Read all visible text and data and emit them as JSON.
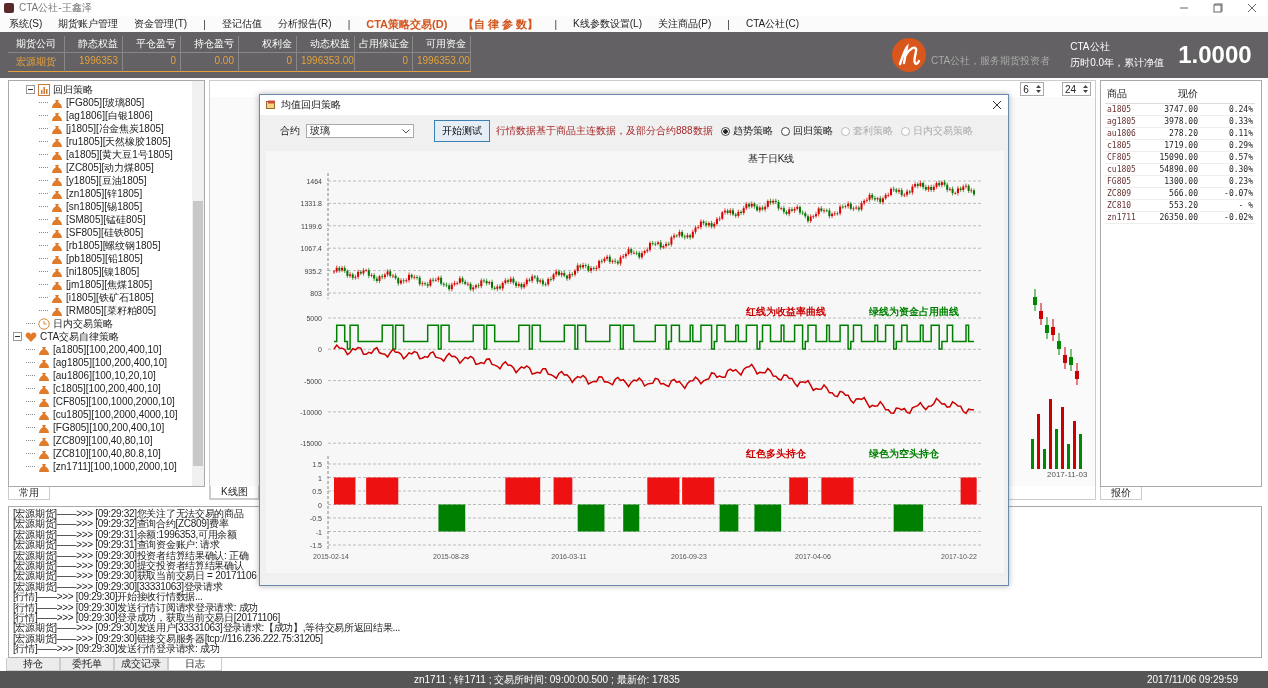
{
  "window": {
    "title": "CTA公社-王鑫泽"
  },
  "menu": [
    {
      "label": "系统(S)",
      "kind": "item"
    },
    {
      "label": "期货账户管理",
      "kind": "item"
    },
    {
      "label": "资金管理(T)",
      "kind": "item"
    },
    {
      "label": "|",
      "kind": "separator"
    },
    {
      "label": "登记估值",
      "kind": "item"
    },
    {
      "label": "分析报告(R)",
      "kind": "item"
    },
    {
      "label": "|",
      "kind": "separator"
    },
    {
      "label": "CTA策略交易(D)",
      "kind": "highlight"
    },
    {
      "label": "【自 律 参 数】",
      "kind": "highlight"
    },
    {
      "label": "|",
      "kind": "separator"
    },
    {
      "label": "K线参数设置(L)",
      "kind": "item"
    },
    {
      "label": "关注商品(P)",
      "kind": "item"
    },
    {
      "label": "|",
      "kind": "separator"
    },
    {
      "label": "CTA公社(C)",
      "kind": "item"
    }
  ],
  "account_table": {
    "columns": [
      "期货公司",
      "静态权益",
      "平仓盈亏",
      "持仓盈亏",
      "权利金",
      "动态权益",
      "占用保证金",
      "可用资金"
    ],
    "rows": [
      [
        "宏源期货",
        "1996353",
        "0",
        "0.00",
        "0",
        "1996353.00",
        "0",
        "1996353.00"
      ]
    ]
  },
  "brand": {
    "tagline": "CTA公社，服务期货投资者",
    "name": "CTA公社",
    "summary": "历时0.0年，累计净值",
    "net_value": "1.0000"
  },
  "tree": {
    "scrolled_branch": [
      {
        "label": "回归策略",
        "kind": "chart",
        "expanded": true,
        "children": [
          {
            "label": "[FG805][玻璃805]",
            "kind": "bag"
          },
          {
            "label": "[ag1806][白银1806]",
            "kind": "bag"
          },
          {
            "label": "[j1805][冶金焦炭1805]",
            "kind": "bag"
          },
          {
            "label": "[ru1805][天然橡胶1805]",
            "kind": "bag"
          },
          {
            "label": "[a1805][黄大豆1号1805]",
            "kind": "bag"
          },
          {
            "label": "[ZC805][动力煤805]",
            "kind": "bag"
          },
          {
            "label": "[y1805][豆油1805]",
            "kind": "bag"
          },
          {
            "label": "[zn1805][锌1805]",
            "kind": "bag"
          },
          {
            "label": "[sn1805][锡1805]",
            "kind": "bag"
          },
          {
            "label": "[SM805][锰硅805]",
            "kind": "bag"
          },
          {
            "label": "[SF805][硅铁805]",
            "kind": "bag"
          },
          {
            "label": "[rb1805][螺纹钢1805]",
            "kind": "bag"
          },
          {
            "label": "[pb1805][铅1805]",
            "kind": "bag"
          },
          {
            "label": "[ni1805][镍1805]",
            "kind": "bag"
          },
          {
            "label": "[jm1805][焦煤1805]",
            "kind": "bag"
          },
          {
            "label": "[i1805][铁矿石1805]",
            "kind": "bag"
          },
          {
            "label": "[RM805][菜籽粕805]",
            "kind": "bag"
          }
        ]
      },
      {
        "label": "日内交易策略",
        "kind": "clock"
      }
    ],
    "items": [
      {
        "label": "CTA交易自律策略",
        "kind": "heart",
        "expanded": true,
        "children": [
          {
            "label": "[a1805][100,200,400,10]",
            "kind": "bag"
          },
          {
            "label": "[ag1805][100,200,400,10]",
            "kind": "bag"
          },
          {
            "label": "[au1806][100,10,20,10]",
            "kind": "bag"
          },
          {
            "label": "[c1805][100,200,400,10]",
            "kind": "bag"
          },
          {
            "label": "[CF805][100,1000,2000,10]",
            "kind": "bag"
          },
          {
            "label": "[cu1805][100,2000,4000,10]",
            "kind": "bag"
          },
          {
            "label": "[FG805][100,200,400,10]",
            "kind": "bag"
          },
          {
            "label": "[ZC809][100,40,80,10]",
            "kind": "bag"
          },
          {
            "label": "[ZC810][100,40,80.8,10]",
            "kind": "bag"
          },
          {
            "label": "[zn1711][100,1000,2000,10]",
            "kind": "bag"
          }
        ]
      }
    ]
  },
  "left_tabs": [
    {
      "label": "常用",
      "selected": true
    }
  ],
  "center": {
    "spinners": [
      "6",
      "24"
    ],
    "date_label": "2017-11-03",
    "tabs": [
      {
        "label": "K线图",
        "selected": true
      }
    ]
  },
  "quotes": {
    "columns": [
      "商品",
      "现价"
    ],
    "rows": [
      {
        "symbol": "a1805",
        "price": "3747.00",
        "change": "0.24%"
      },
      {
        "symbol": "ag1805",
        "price": "3978.00",
        "change": "0.33%"
      },
      {
        "symbol": "au1806",
        "price": "278.20",
        "change": "0.11%"
      },
      {
        "symbol": "c1805",
        "price": "1719.00",
        "change": "0.29%"
      },
      {
        "symbol": "CF805",
        "price": "15090.00",
        "change": "0.57%"
      },
      {
        "symbol": "cu1805",
        "price": "54890.00",
        "change": "0.30%"
      },
      {
        "symbol": "FG805",
        "price": "1300.00",
        "change": "0.23%"
      },
      {
        "symbol": "ZC809",
        "price": "566.00",
        "change": "-0.07%"
      },
      {
        "symbol": "ZC810",
        "price": "553.20",
        "change": "- %"
      },
      {
        "symbol": "zn1711",
        "price": "26350.00",
        "change": "-0.02%"
      }
    ]
  },
  "right_tabs": [
    {
      "label": "报价",
      "selected": true
    }
  ],
  "dialog": {
    "title": "均值回归策略",
    "contract_label": "合约",
    "contract_value": "玻璃",
    "start_button": "开始测试",
    "note": "行情数据基于商品主连数据，及部分合约888数据",
    "radios": [
      {
        "label": "趋势策略",
        "selected": true,
        "disabled": false
      },
      {
        "label": "回归策略",
        "selected": false,
        "disabled": false
      },
      {
        "label": "套利策略",
        "selected": false,
        "disabled": true
      },
      {
        "label": "日内交易策略",
        "selected": false,
        "disabled": true
      }
    ],
    "panels": [
      {
        "kind": "candles",
        "title": "基于日K线",
        "y_labels": [
          "1464",
          "1331.8",
          "1199.6",
          "1067.4",
          "935.2",
          "803"
        ]
      },
      {
        "kind": "equity",
        "legends": [
          {
            "text": "红线为收益率曲线",
            "color": "#cc0000"
          },
          {
            "text": "绿线为资金占用曲线",
            "color": "#008000"
          }
        ],
        "y_labels": [
          "5000",
          "0",
          "-5000",
          "-10000",
          "-15000"
        ]
      },
      {
        "kind": "positions",
        "legends": [
          {
            "text": "红色多头持仓",
            "color": "#cc0000"
          },
          {
            "text": "绿色为空头持仓",
            "color": "#008000"
          }
        ],
        "y_labels": [
          "1.5",
          "1",
          "0.5",
          "0",
          "-0.5",
          "-1",
          "-1.5"
        ],
        "x_labels": [
          "2015-02-14",
          "2015-08-28",
          "2016-03-11",
          "2016-09-23",
          "2017-04-06",
          "2017-10-22"
        ]
      }
    ]
  },
  "log": [
    "[宏源期货]——>>> [09:29:32]您关注了无法交易的商品",
    "[宏源期货]——>>> [09:29:32]查询合约[ZC809]费率",
    "[宏源期货]——>>> [09:29:31]余额:1996353,可用余额",
    "[宏源期货]——>>> [09:29:31]查询资金账户: 请求",
    "[宏源期货]——>>> [09:29:30]投资者结算结果确认: 正确",
    "[宏源期货]——>>> [09:29:30]提交投资者结算结果确认",
    "[宏源期货]——>>> [09:29:30]获取当前交易日 = 20171106",
    "[宏源期货]——>>> [09:29:30][33331063]登录请求",
    "[行情]——>>> [09:29:30]开始接收行情数据...",
    "[行情]——>>> [09:29:30]发送行情订阅请求登录请求: 成功",
    "[行情]——>>> [09:29:30]登录成功，获取当前交易日[20171106]",
    "[宏源期货]——>>> [09:29:30]发送用户[33331063]登录请求:【成功】,等待交易所返回结果...",
    "[宏源期货]——>>> [09:29:30]链接交易服务器[tcp://116.236.222.75:31205]",
    "[行情]——>>> [09:29:30]发送行情登录请求: 成功"
  ],
  "bottom_tabs": [
    {
      "label": "持仓",
      "selected": false
    },
    {
      "label": "委托单",
      "selected": false
    },
    {
      "label": "成交记录",
      "selected": false
    },
    {
      "label": "日志",
      "selected": true
    }
  ],
  "status_bar": {
    "instrument": "zn1711 ; 锌1711 ; 交易所时间: 09:00:00.500 ; 最新价: 17835",
    "datetime": "2017/11/06 09:29:59"
  }
}
